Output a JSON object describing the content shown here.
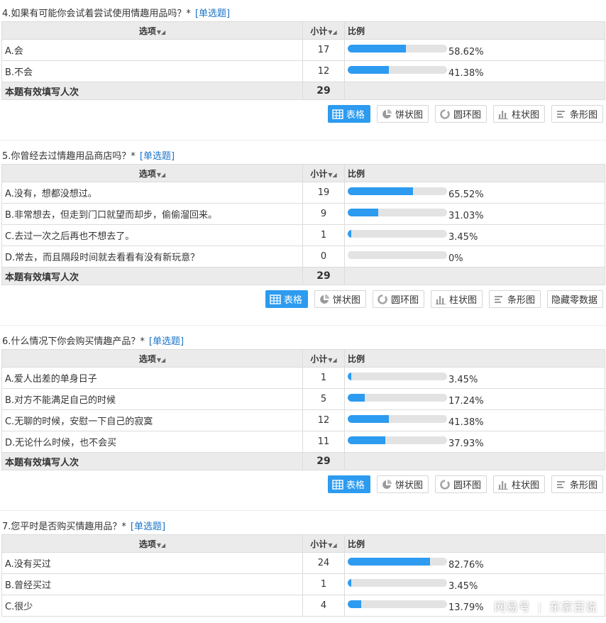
{
  "header": {
    "option": "选项",
    "count": "小计",
    "ratio": "比例"
  },
  "total_label": "本题有效填写人次",
  "colors": {
    "accent": "#2c9bf0",
    "track": "#e3e3e3",
    "header_bg": "#ebebeb",
    "link": "#1a73c8"
  },
  "questions": [
    {
      "title": "4.如果有可能你会试着尝试使用情趣用品吗？*",
      "type": "[单选题]",
      "rows": [
        {
          "label": "A.会",
          "count": "17",
          "percent": "58.62%",
          "value": 58.62
        },
        {
          "label": "B.不会",
          "count": "12",
          "percent": "41.38%",
          "value": 41.38
        }
      ],
      "total": "29",
      "buttons": [
        "表格",
        "饼状图",
        "圆环图",
        "柱状图",
        "条形图"
      ]
    },
    {
      "title": "5.你曾经去过情趣用品商店吗？*",
      "type": "[单选题]",
      "rows": [
        {
          "label": "A.没有，想都没想过。",
          "count": "19",
          "percent": "65.52%",
          "value": 65.52
        },
        {
          "label": "B.非常想去，但走到门口就望而却步，偷偷溜回来。",
          "count": "9",
          "percent": "31.03%",
          "value": 31.03
        },
        {
          "label": "C.去过一次之后再也不想去了。",
          "count": "1",
          "percent": "3.45%",
          "value": 3.45
        },
        {
          "label": "D.常去，而且隔段时间就去看看有没有新玩意？",
          "count": "0",
          "percent": "0%",
          "value": 0
        }
      ],
      "total": "29",
      "buttons": [
        "表格",
        "饼状图",
        "圆环图",
        "柱状图",
        "条形图",
        "隐藏零数据"
      ]
    },
    {
      "title": "6.什么情况下你会购买情趣产品？*",
      "type": "[单选题]",
      "rows": [
        {
          "label": "A.爱人出差的单身日子",
          "count": "1",
          "percent": "3.45%",
          "value": 3.45
        },
        {
          "label": "B.对方不能满足自己的时候",
          "count": "5",
          "percent": "17.24%",
          "value": 17.24
        },
        {
          "label": "C.无聊的时候，安慰一下自己的寂寞",
          "count": "12",
          "percent": "41.38%",
          "value": 41.38
        },
        {
          "label": "D.无论什么时候，也不会买",
          "count": "11",
          "percent": "37.93%",
          "value": 37.93
        }
      ],
      "total": "29",
      "buttons": [
        "表格",
        "饼状图",
        "圆环图",
        "柱状图",
        "条形图"
      ]
    },
    {
      "title": "7.您平时是否购买情趣用品？*",
      "type": "[单选题]",
      "rows": [
        {
          "label": "A.没有买过",
          "count": "24",
          "percent": "82.76%",
          "value": 82.76
        },
        {
          "label": "B.曾经买过",
          "count": "1",
          "percent": "3.45%",
          "value": 3.45
        },
        {
          "label": "C.很少",
          "count": "4",
          "percent": "13.79%",
          "value": 13.79
        }
      ],
      "total": null,
      "buttons": []
    }
  ],
  "watermark": {
    "brand": "网易号",
    "author": "东家百说"
  }
}
